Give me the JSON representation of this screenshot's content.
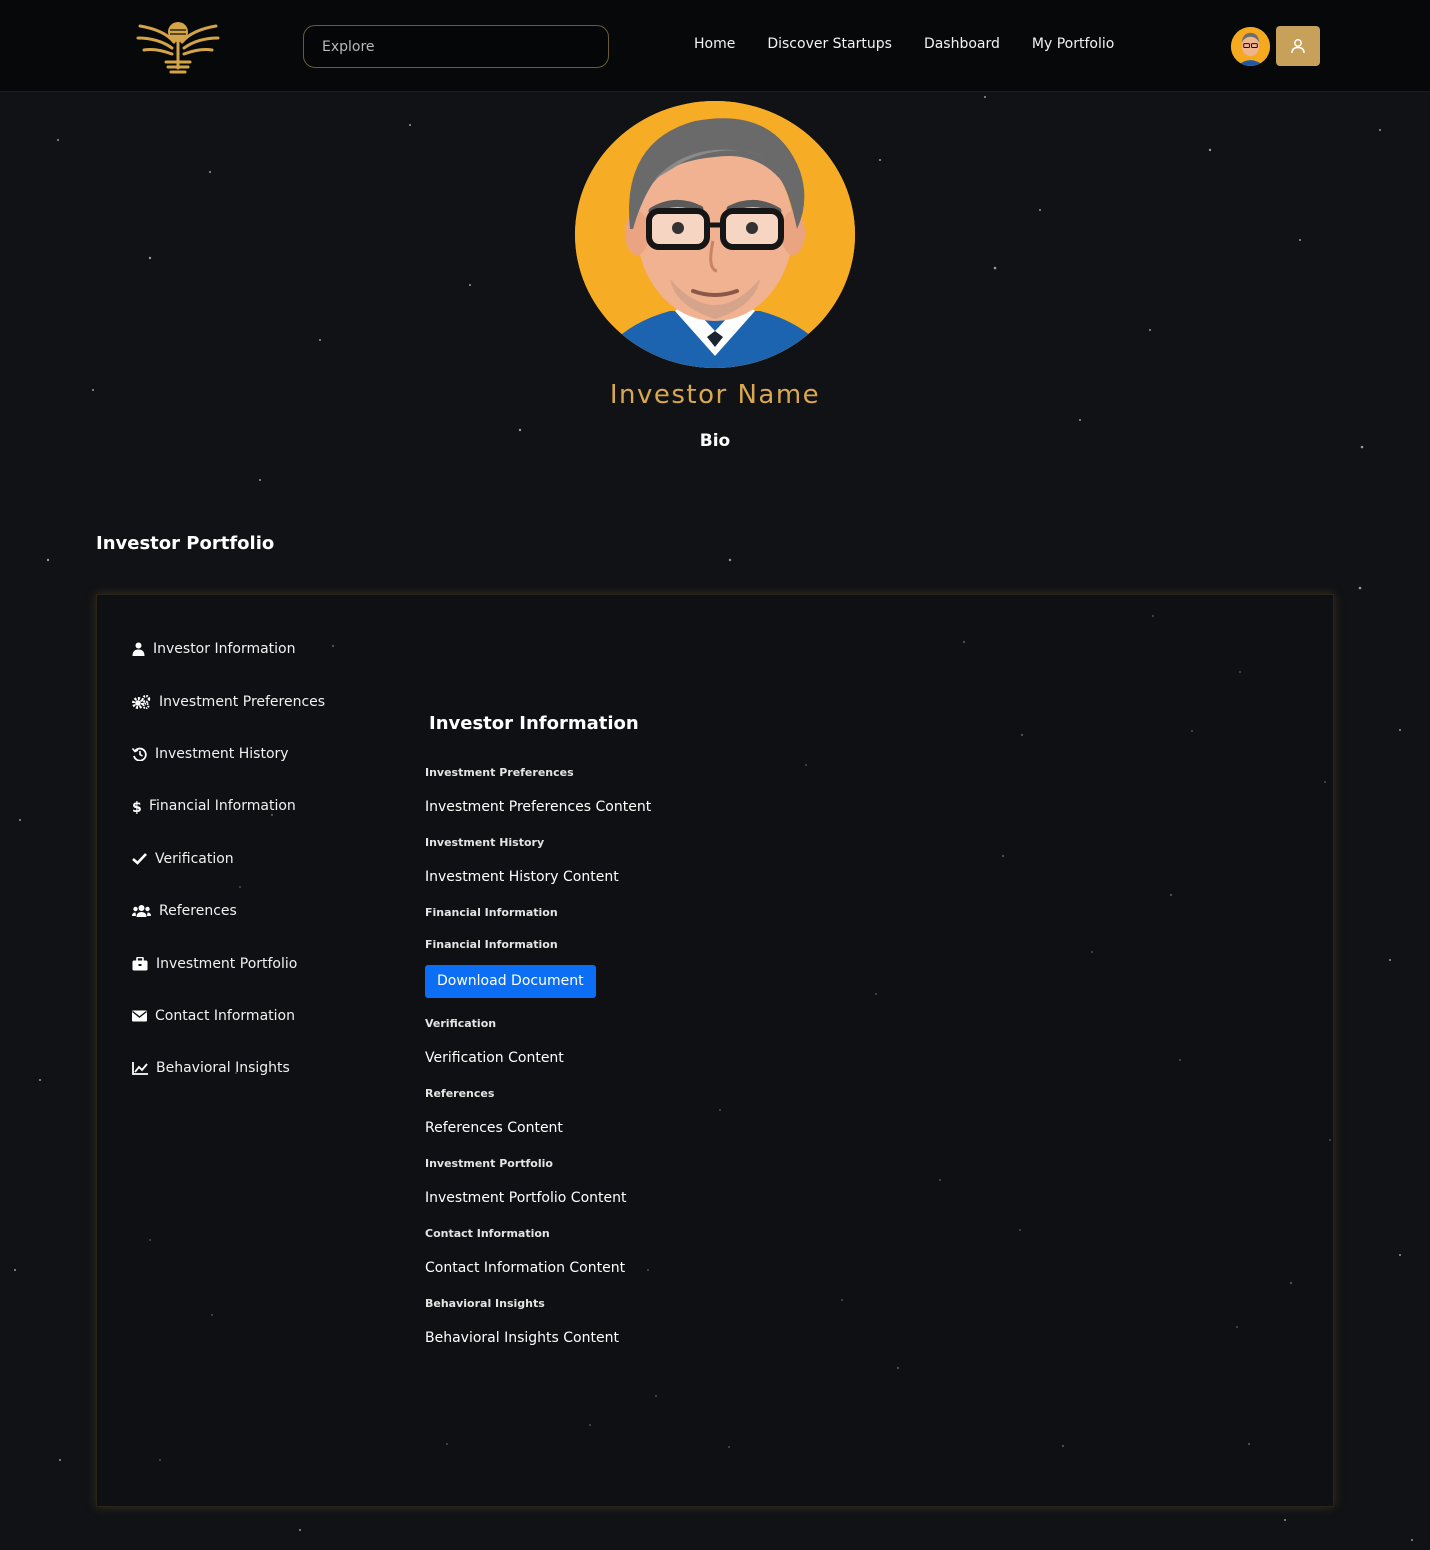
{
  "colors": {
    "accent_gold": "#d9a74f",
    "button_blue": "#0b6ef5",
    "background": "#101215",
    "navbar": "#07080a"
  },
  "navbar": {
    "logo_icon": "golden-tree-logo",
    "search_placeholder": "Explore",
    "links": [
      "Home",
      "Discover Startups",
      "Dashboard",
      "My Portfolio"
    ],
    "avatar_icon": "investor-avatar",
    "user_button_icon": "user-icon"
  },
  "profile": {
    "name": "Investor Name",
    "bio": "Bio"
  },
  "portfolio": {
    "title": "Investor Portfolio",
    "sidebar": [
      {
        "icon": "user-icon",
        "label": "Investor Information"
      },
      {
        "icon": "gears-icon",
        "label": "Investment Preferences"
      },
      {
        "icon": "history-icon",
        "label": "Investment History"
      },
      {
        "icon": "dollar-icon",
        "label": "Financial Information"
      },
      {
        "icon": "check-icon",
        "label": "Verification"
      },
      {
        "icon": "users-icon",
        "label": "References"
      },
      {
        "icon": "briefcase-icon",
        "label": "Investment Portfolio"
      },
      {
        "icon": "envelope-icon",
        "label": "Contact Information"
      },
      {
        "icon": "chart-line-icon",
        "label": "Behavioral Insights"
      }
    ],
    "content": {
      "title": "Investor Information",
      "preferences_label": "Investment Preferences",
      "preferences_value": "Investment Preferences Content",
      "history_label": "Investment History",
      "history_value": "Investment History Content",
      "financial_label": "Financial Information",
      "financial_sublabel": "Financial Information",
      "download_label": "Download Document",
      "verification_label": "Verification",
      "verification_value": "Verification Content",
      "references_label": "References",
      "references_value": "References Content",
      "portfolio_label": "Investment Portfolio",
      "portfolio_value": "Investment Portfolio Content",
      "contact_label": "Contact Information",
      "contact_value": "Contact Information Content",
      "behavioral_label": "Behavioral Insights",
      "behavioral_value": "Behavioral Insights Content"
    }
  }
}
